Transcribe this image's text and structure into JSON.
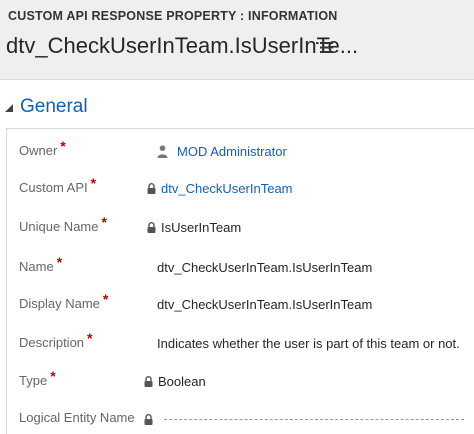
{
  "header": {
    "entity_label": "CUSTOM API RESPONSE PROPERTY : INFORMATION",
    "record_title": "dtv_CheckUserInTeam.IsUserInTe..."
  },
  "section": {
    "title": "General"
  },
  "fields": [
    {
      "label": "Owner",
      "required": "*",
      "value": "MOD Administrator",
      "kind": "user-link",
      "locked": false
    },
    {
      "label": "Custom API",
      "required": "*",
      "value": "dtv_CheckUserInTeam",
      "kind": "link",
      "locked": true
    },
    {
      "label": "Unique Name",
      "required": "*",
      "value": "IsUserInTeam",
      "kind": "text",
      "locked": true
    },
    {
      "label": "Name",
      "required": "*",
      "value": "dtv_CheckUserInTeam.IsUserInTeam",
      "kind": "text",
      "locked": false
    },
    {
      "label": "Display Name",
      "required": "*",
      "value": "dtv_CheckUserInTeam.IsUserInTeam",
      "kind": "text",
      "locked": false
    },
    {
      "label": "Description",
      "required": "*",
      "value": "Indicates whether the user is part of this team or not.",
      "kind": "text",
      "locked": false
    },
    {
      "label": "Type",
      "required": "*",
      "value": "Boolean",
      "kind": "text",
      "locked": true
    },
    {
      "label": "Logical Entity Name",
      "required": "",
      "value": "",
      "kind": "empty",
      "locked": true
    }
  ],
  "colors": {
    "accent": "#1160b7",
    "required": "#c00000",
    "header_bg": "#efefef"
  },
  "icons": [
    "menu-list-icon",
    "collapse-triangle-icon",
    "user-icon",
    "lock-icon"
  ]
}
